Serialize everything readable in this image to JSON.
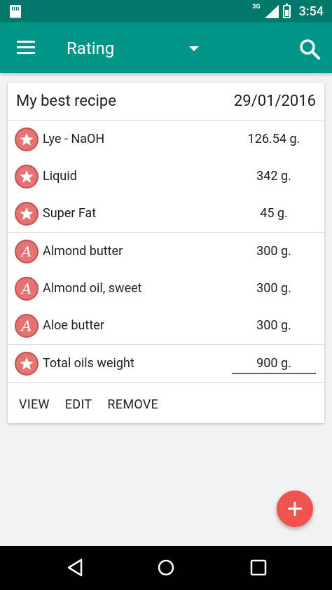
{
  "status_bar": {
    "network": "3G",
    "time": "3:54"
  },
  "app_bar": {
    "title": "Rating"
  },
  "recipe": {
    "name": "My best recipe",
    "date": "29/01/2016",
    "base_items": [
      {
        "label": "Lye - NaOH",
        "value": "126.54 g.",
        "icon": "star-icon"
      },
      {
        "label": "Liquid",
        "value": "342 g.",
        "icon": "star-icon"
      },
      {
        "label": "Super Fat",
        "value": "45 g.",
        "icon": "star-icon"
      }
    ],
    "oils": [
      {
        "label": "Almond butter",
        "value": "300 g.",
        "icon": "letter-a-icon",
        "glyph": "A"
      },
      {
        "label": "Almond oil, sweet",
        "value": "300 g.",
        "icon": "letter-a-icon",
        "glyph": "A"
      },
      {
        "label": "Aloe butter",
        "value": "300 g.",
        "icon": "letter-a-icon",
        "glyph": "A"
      }
    ],
    "total": {
      "label": "Total oils weight",
      "value": "900 g.",
      "icon": "star-icon"
    }
  },
  "actions": {
    "view": "VIEW",
    "edit": "EDIT",
    "remove": "REMOVE"
  },
  "colors": {
    "status_bar": "#00796b",
    "primary": "#009688",
    "accent": "#ef5350",
    "icon_fill": "#e57373"
  }
}
